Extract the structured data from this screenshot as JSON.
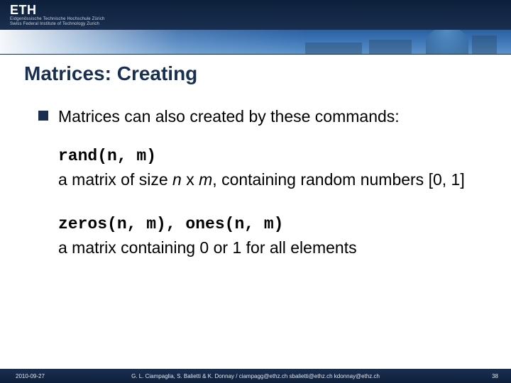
{
  "header": {
    "logo": "ETH",
    "sub1": "Eidgenössische Technische Hochschule Zürich",
    "sub2": "Swiss Federal Institute of Technology Zurich"
  },
  "title": "Matrices: Creating",
  "bullet": "Matrices can also created by these commands:",
  "blocks": [
    {
      "code": "rand(n, m)",
      "desc_pre": "a matrix of size ",
      "desc_em1": "n",
      "desc_mid": " x ",
      "desc_em2": "m",
      "desc_post": ", containing random numbers [0, 1]"
    },
    {
      "code": "zeros(n, m), ones(n, m)",
      "desc_pre": "a matrix containing 0 or 1 for all elements",
      "desc_em1": "",
      "desc_mid": "",
      "desc_em2": "",
      "desc_post": ""
    }
  ],
  "footer": {
    "date": "2010-09-27",
    "credits": "G. L. Ciampaglia, S. Balietti & K. Donnay /  ciampagg@ethz.ch  sbalietti@ethz.ch  kdonnay@ethz.ch",
    "page": "38"
  }
}
